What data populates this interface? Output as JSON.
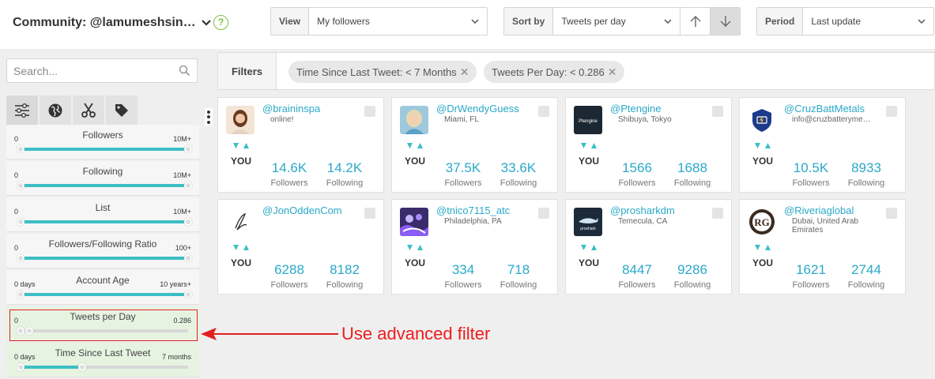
{
  "header": {
    "community_label": "Community: @lamumeshsin…",
    "help": "?"
  },
  "controls": {
    "view": {
      "label": "View",
      "value": "My followers"
    },
    "sort": {
      "label": "Sort by",
      "value": "Tweets per day"
    },
    "period": {
      "label": "Period",
      "value": "Last update"
    }
  },
  "search": {
    "placeholder": "Search..."
  },
  "sidebar_tabs": [
    "filters-icon",
    "globe-icon",
    "scissors-icon",
    "tag-icon"
  ],
  "filters": [
    {
      "name": "Followers",
      "min": "0",
      "max": "10M+",
      "lo": 0,
      "hi": 1,
      "applied": false
    },
    {
      "name": "Following",
      "min": "0",
      "max": "10M+",
      "lo": 0,
      "hi": 1,
      "applied": false
    },
    {
      "name": "List",
      "min": "0",
      "max": "10M+",
      "lo": 0,
      "hi": 1,
      "applied": false
    },
    {
      "name": "Followers/Following Ratio",
      "min": "0",
      "max": "100+",
      "lo": 0,
      "hi": 1,
      "applied": false
    },
    {
      "name": "Account Age",
      "min": "0 days",
      "max": "10 years+",
      "lo": 0,
      "hi": 1,
      "applied": false
    },
    {
      "name": "Tweets per Day",
      "min": "0",
      "max": "0.286",
      "lo": 0,
      "hi": 0.05,
      "applied": true
    },
    {
      "name": "Time Since Last Tweet",
      "min": "0 days",
      "max": "7 months",
      "lo": 0,
      "hi": 0.37,
      "applied": true
    }
  ],
  "filters_bar": {
    "label": "Filters",
    "chips": [
      "Time Since Last Tweet: < 7 Months",
      "Tweets Per Day: < 0.286"
    ]
  },
  "annotation": {
    "text": "Use advanced filter",
    "color": "#ee1c1c"
  },
  "cards": [
    {
      "handle": "@braininspa",
      "location": "online!",
      "you": "YOU",
      "followers": "14.6K",
      "following": "14.2K",
      "avatar": "woman-portrait"
    },
    {
      "handle": "@DrWendyGuess",
      "location": "Miami, FL",
      "you": "YOU",
      "followers": "37.5K",
      "following": "33.6K",
      "avatar": "blonde-portrait"
    },
    {
      "handle": "@Ptengine",
      "location": "Shibuya, Tokyo",
      "you": "YOU",
      "followers": "1566",
      "following": "1688",
      "avatar": "ptengine-logo",
      "avatar_text": "Ptengine"
    },
    {
      "handle": "@CruzBattMetals",
      "location": "info@cruzbatteryme…",
      "you": "YOU",
      "followers": "10.5K",
      "following": "8933",
      "avatar": "shield-battery-logo"
    },
    {
      "handle": "@JonOddenCom",
      "location": "",
      "you": "YOU",
      "followers": "6288",
      "following": "8182",
      "avatar": "signature-logo"
    },
    {
      "handle": "@tnico7115_atc",
      "location": "Philadelphia, PA",
      "you": "YOU",
      "followers": "334",
      "following": "718",
      "avatar": "purple-creature"
    },
    {
      "handle": "@prosharkdm",
      "location": "Temecula, CA",
      "you": "YOU",
      "followers": "8447",
      "following": "9286",
      "avatar": "proshark-logo",
      "avatar_text": "proshark"
    },
    {
      "handle": "@Riveriaglobal",
      "location": "Dubai, United Arab Emirates",
      "you": "YOU",
      "followers": "1621",
      "following": "2744",
      "avatar": "rg-logo",
      "avatar_text": "RG"
    }
  ],
  "stat_labels": {
    "followers": "Followers",
    "following": "Following"
  }
}
